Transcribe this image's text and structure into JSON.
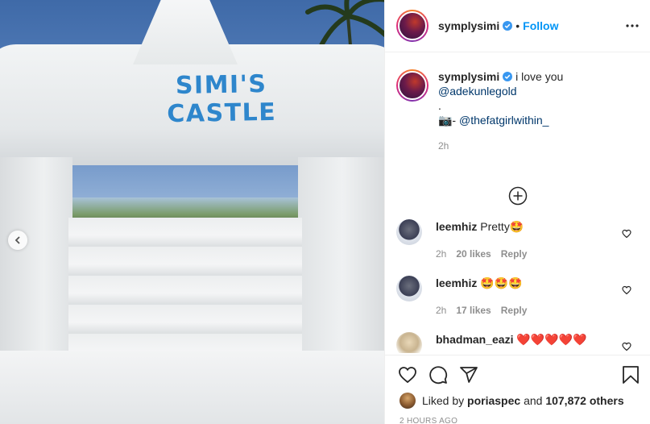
{
  "media": {
    "castle_title": "SIMI'S CASTLE"
  },
  "post": {
    "author": "symplysimi",
    "follow_label": "Follow",
    "separator": "•",
    "caption_text": "i love you",
    "caption_mention": "@adekunlegold",
    "caption_dot": ".",
    "caption_camera": "📷- ",
    "caption_credit": "@thefatgirlwithin_",
    "time": "2h"
  },
  "comments": [
    {
      "user": "leemhiz",
      "text": "Pretty🤩",
      "time": "2h",
      "likes": "20 likes",
      "reply": "Reply"
    },
    {
      "user": "leemhiz",
      "text": "🤩🤩🤩",
      "time": "2h",
      "likes": "17 likes",
      "reply": "Reply"
    },
    {
      "user": "bhadman_eazi",
      "text": "❤️❤️❤️❤️❤️",
      "time": "",
      "likes": "",
      "reply": ""
    }
  ],
  "likes": {
    "prefix": "Liked by ",
    "user": "poriaspec",
    "middle": " and ",
    "count": "107,872 others"
  },
  "timestamp": "2 HOURS AGO",
  "colors": {
    "accent": "#0095f6",
    "mention": "#00376b",
    "castle_text": "#2e86cc"
  }
}
